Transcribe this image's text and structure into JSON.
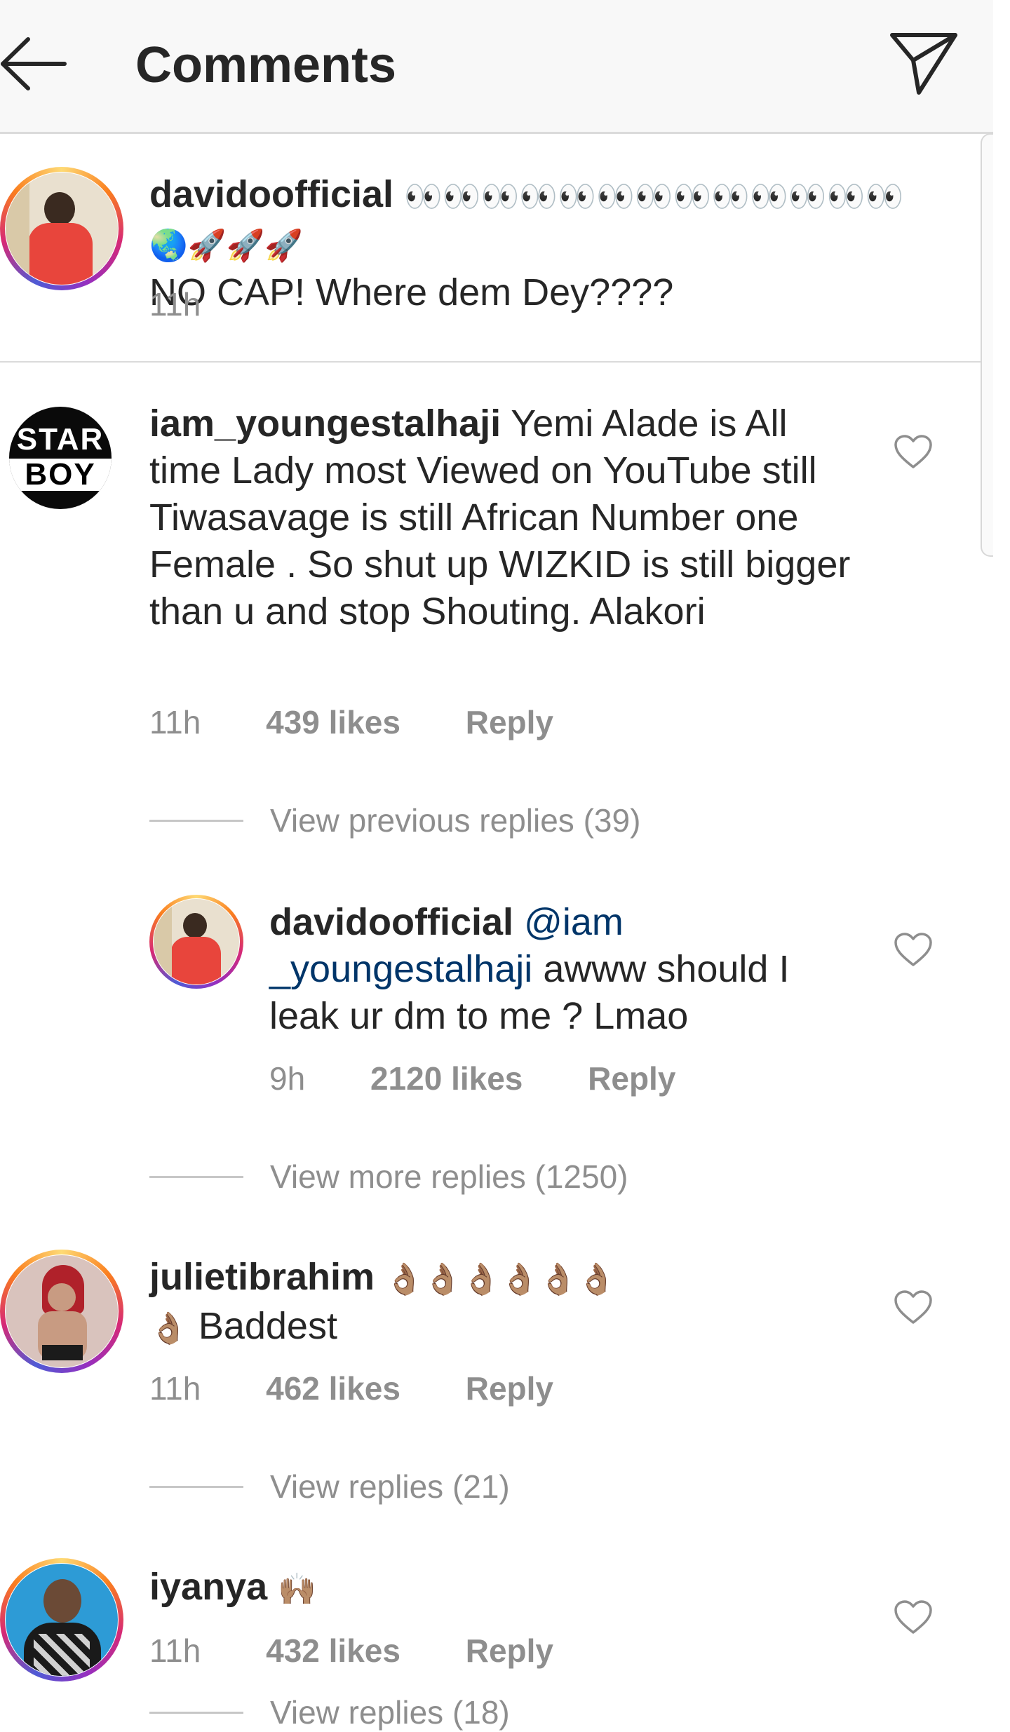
{
  "header": {
    "title": "Comments"
  },
  "comments": [
    {
      "username": "davidoofficial",
      "emojis": "👀👀👀👀👀👀👀👀👀👀👀👀👀🌏🚀🚀🚀",
      "text": "NO CAP! Where dem Dey????",
      "time": "11h"
    },
    {
      "username": "iam_youngestalhaji",
      "text": "Yemi Alade is All time Lady most Viewed on YouTube still Tiwasavage is still African Number one Female . So shut up WIZKID is still bigger than u and stop Shouting. Alakori",
      "time": "11h",
      "likes": "439 likes",
      "reply": "Reply",
      "avatar_text": [
        "STAR",
        "BOY"
      ],
      "view_previous": "View previous replies (39)",
      "reply_item": {
        "username": "davidoofficial",
        "mention": "@iam _youngestalhaji",
        "text": "awww should I leak ur dm to me ? Lmao",
        "time": "9h",
        "likes": "2120 likes",
        "reply": "Reply"
      },
      "view_more": "View more replies (1250)"
    },
    {
      "username": "julietibrahim",
      "emojis": "👌🏽👌🏽👌🏽👌🏽👌🏽👌🏽",
      "emoji2": "👌🏽",
      "text": "Baddest",
      "time": "11h",
      "likes": "462 likes",
      "reply": "Reply",
      "view_replies": "View replies (21)"
    },
    {
      "username": "iyanya",
      "emojis": "🙌🏽",
      "time": "11h",
      "likes": "432 likes",
      "reply": "Reply",
      "view_replies": "View replies (18)"
    }
  ],
  "colors": {
    "text": "#262626",
    "muted": "#8e8e8e",
    "mention": "#003569",
    "divider": "#dbdbdb"
  },
  "icons": {
    "back": "arrow-left-icon",
    "send": "paper-plane-icon",
    "like": "heart-outline-icon"
  }
}
